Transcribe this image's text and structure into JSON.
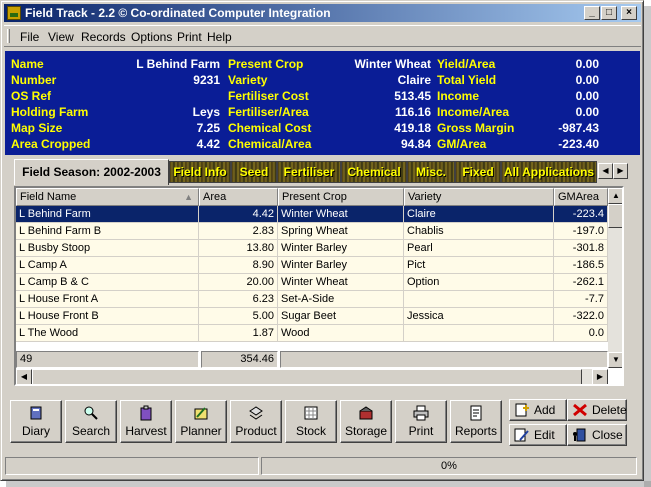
{
  "window": {
    "title": "Field Track - 2.2 © Co-ordinated Computer Integration"
  },
  "menu": [
    {
      "label": "File"
    },
    {
      "label": "View"
    },
    {
      "label": "Records"
    },
    {
      "label": "Options"
    },
    {
      "label": "Print"
    },
    {
      "label": "Help"
    }
  ],
  "summary": {
    "col1": [
      {
        "label": "Name",
        "value": "L Behind Farm"
      },
      {
        "label": "Number",
        "value": "9231"
      },
      {
        "label": "OS Ref",
        "value": ""
      },
      {
        "label": "Holding Farm",
        "value": "Leys"
      },
      {
        "label": "Map Size",
        "value": "7.25"
      },
      {
        "label": "Area Cropped",
        "value": "4.42"
      }
    ],
    "col2": [
      {
        "label": "Present Crop",
        "value": "Winter Wheat"
      },
      {
        "label": "Variety",
        "value": "Claire"
      },
      {
        "label": "Fertiliser Cost",
        "value": "513.45"
      },
      {
        "label": "Fertiliser/Area",
        "value": "116.16"
      },
      {
        "label": "Chemical Cost",
        "value": "419.18"
      },
      {
        "label": "Chemical/Area",
        "value": "94.84"
      }
    ],
    "col3": [
      {
        "label": "Yield/Area",
        "value": "0.00"
      },
      {
        "label": "Total Yield",
        "value": "0.00"
      },
      {
        "label": "Income",
        "value": "0.00"
      },
      {
        "label": "Income/Area",
        "value": "0.00"
      },
      {
        "label": "Gross Margin",
        "value": "-987.43"
      },
      {
        "label": "GM/Area",
        "value": "-223.40"
      }
    ]
  },
  "tabs": {
    "active": "Field Season: 2002-2003",
    "items": [
      "Field Info",
      "Seed",
      "Fertiliser",
      "Chemical",
      "Misc.",
      "Fixed",
      "All Applications"
    ]
  },
  "grid": {
    "columns": [
      "Field Name",
      "Area",
      "Present Crop",
      "Variety",
      "GMArea"
    ],
    "rows": [
      {
        "field": "L Behind Farm",
        "area": "4.42",
        "crop": "Winter Wheat",
        "variety": "Claire",
        "gm": "-223.4"
      },
      {
        "field": "L Behind Farm B",
        "area": "2.83",
        "crop": "Spring Wheat",
        "variety": "Chablis",
        "gm": "-197.0"
      },
      {
        "field": "L Busby Stoop",
        "area": "13.80",
        "crop": "Winter Barley",
        "variety": "Pearl",
        "gm": "-301.8"
      },
      {
        "field": "L Camp A",
        "area": "8.90",
        "crop": "Winter Barley",
        "variety": "Pict",
        "gm": "-186.5"
      },
      {
        "field": "L Camp B & C",
        "area": "20.00",
        "crop": "Winter Wheat",
        "variety": "Option",
        "gm": "-262.1"
      },
      {
        "field": "L House Front A",
        "area": "6.23",
        "crop": "Set-A-Side",
        "variety": "",
        "gm": "-7.7"
      },
      {
        "field": "L House Front B",
        "area": "5.00",
        "crop": "Sugar Beet",
        "variety": "Jessica",
        "gm": "-322.0"
      },
      {
        "field": "L The Wood",
        "area": "1.87",
        "crop": "Wood",
        "variety": "",
        "gm": "0.0"
      }
    ],
    "footer": {
      "count": "49",
      "area_total": "354.46"
    }
  },
  "buttons": [
    "Diary",
    "Search",
    "Harvest",
    "Planner",
    "Product",
    "Stock",
    "Storage",
    "Print",
    "Reports"
  ],
  "actions": {
    "add": "Add",
    "delete": "Delete",
    "edit": "Edit",
    "close": "Close"
  },
  "status": {
    "progress": "0%"
  },
  "colors": {
    "summary_bg": "#0a1d96",
    "label": "#ffff00",
    "selection": "#0a246a"
  }
}
